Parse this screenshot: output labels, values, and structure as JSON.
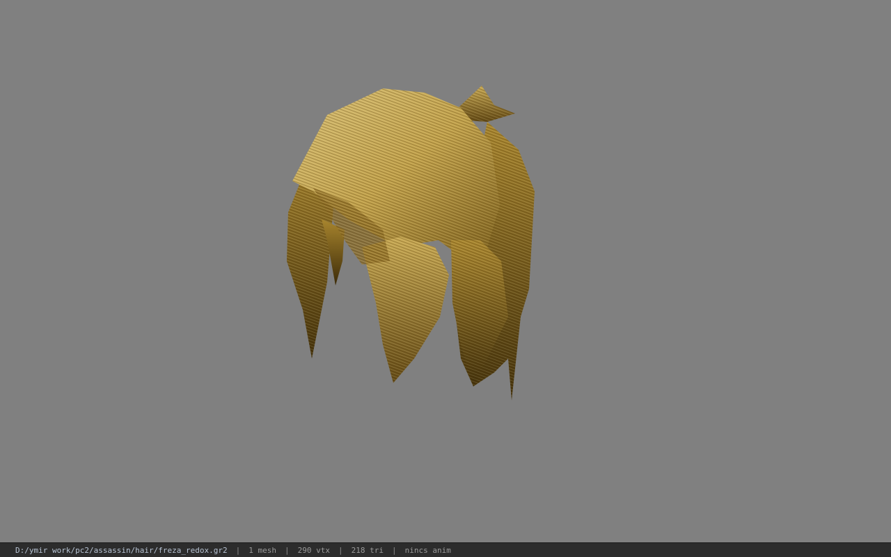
{
  "viewport": {
    "background": "#808080",
    "model_icon": "hair-mesh-render"
  },
  "status": {
    "file_path": "D:/ymir work/pc2/assassin/hair/freza_redox.gr2",
    "separator": "|",
    "mesh": "1 mesh",
    "vertices": "290 vtx",
    "triangles": "218 tri",
    "animation": "nincs anim"
  }
}
